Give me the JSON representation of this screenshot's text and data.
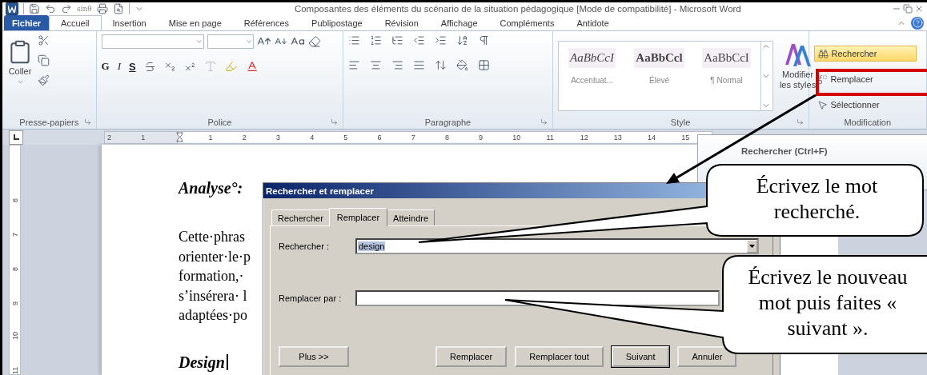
{
  "title_bar": {
    "title": "Composantes des éléments du scénario de la situation pédagogique [Mode de compatibilité]  -  Microsoft Word",
    "formula_button": "sinθ"
  },
  "ribbon_tabs": [
    {
      "label": "Fichier",
      "kind": "file",
      "selected": false
    },
    {
      "label": "Accueil",
      "kind": "tab",
      "selected": true
    },
    {
      "label": "Insertion",
      "kind": "tab",
      "selected": false
    },
    {
      "label": "Mise en page",
      "kind": "tab",
      "selected": false
    },
    {
      "label": "Références",
      "kind": "tab",
      "selected": false
    },
    {
      "label": "Publipostage",
      "kind": "tab",
      "selected": false
    },
    {
      "label": "Révision",
      "kind": "tab",
      "selected": false
    },
    {
      "label": "Affichage",
      "kind": "tab",
      "selected": false
    },
    {
      "label": "Compléments",
      "kind": "tab",
      "selected": false
    },
    {
      "label": "Antidote",
      "kind": "tab",
      "selected": false
    }
  ],
  "ribbon": {
    "groups": [
      {
        "kind": "clipboard",
        "label": "Presse-papiers",
        "launcher": true,
        "paste": "Coller"
      },
      {
        "kind": "font",
        "label": "Police",
        "launcher": true,
        "format_buttons": [
          "G",
          "I",
          "S"
        ]
      },
      {
        "kind": "paragraph",
        "label": "Paragraphe",
        "launcher": true
      },
      {
        "kind": "styles",
        "label": "Style",
        "launcher": true,
        "samples": [
          {
            "kind": "emphasis",
            "preview": "AaBbCcI",
            "label": "Accentuat..."
          },
          {
            "kind": "strong",
            "preview": "AaBbCcl",
            "label": "Élevé"
          },
          {
            "kind": "normal",
            "preview": "AaBbCcI",
            "label": "¶ Normal"
          }
        ],
        "change_styles": "Modifier les styles"
      },
      {
        "kind": "editing",
        "label": "Modification",
        "items": [
          {
            "label": "Rechercher",
            "highlighted": true
          },
          {
            "label": "Remplacer",
            "highlighted": false
          },
          {
            "label": "Sélectionner",
            "highlighted": false
          }
        ]
      }
    ]
  },
  "rulers": {
    "horizontal": [
      "2",
      "1",
      "1",
      "2",
      "3",
      "4",
      "5",
      "6",
      "7",
      "8",
      "9",
      "10",
      "11",
      "12",
      "13",
      "14",
      "15"
    ],
    "vertical": [
      "6",
      "7",
      "8",
      "9",
      "10",
      "11"
    ]
  },
  "document": {
    "blocks": [
      {
        "kind": "heading",
        "text": "Analyse°:"
      },
      {
        "kind": "paragraph",
        "lines": [
          "Cette·phras",
          "orienter·le·p",
          "formation,·",
          "s’insérera· l",
          "adaptées·po"
        ]
      },
      {
        "kind": "heading",
        "text": "Design"
      }
    ]
  },
  "tooltip": {
    "title": "Rechercher (Ctrl+F)"
  },
  "dialog": {
    "title": "Rechercher et remplacer",
    "tabs": [
      {
        "label": "Rechercher",
        "selected": false
      },
      {
        "label": "Remplacer",
        "selected": true
      },
      {
        "label": "Atteindre",
        "selected": false
      }
    ],
    "fields": [
      {
        "label": "Rechercher :",
        "value": "design",
        "value_selected": true
      },
      {
        "label": "Remplacer par :"
      }
    ],
    "buttons": [
      {
        "label": "Plus >>",
        "default": false,
        "kind": "more"
      },
      {
        "label": "Remplacer",
        "default": false,
        "kind": "action"
      },
      {
        "label": "Remplacer tout",
        "default": false,
        "kind": "action"
      },
      {
        "label": "Suivant",
        "default": true,
        "kind": "action"
      },
      {
        "label": "Annuler",
        "default": false,
        "kind": "action"
      }
    ]
  },
  "callouts": [
    {
      "text": "Écrivez le mot recherché."
    },
    {
      "text": "Écrivez le nouveau mot puis faites « suivant »."
    }
  ]
}
